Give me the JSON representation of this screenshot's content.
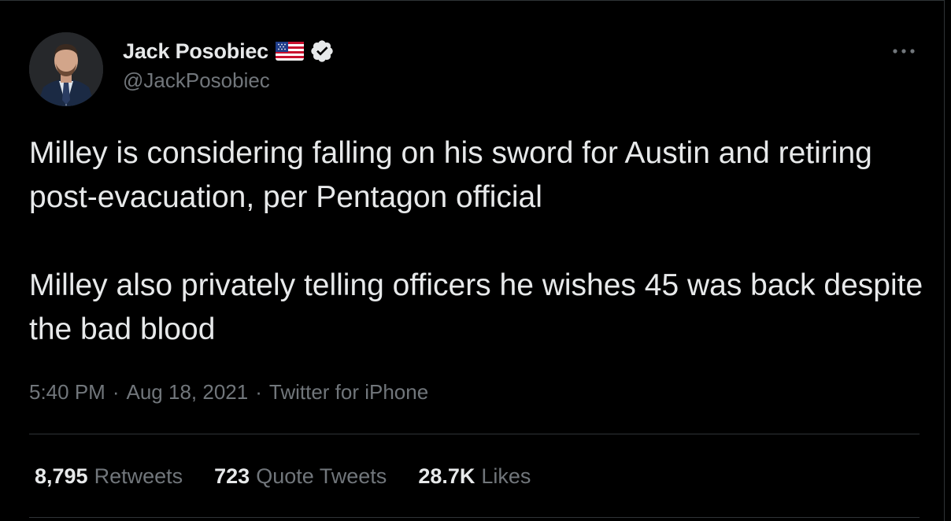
{
  "author": {
    "display_name": "Jack Posobiec",
    "handle": "@JackPosobiec",
    "flag_icon": "us-flag-icon",
    "verified_icon": "verified-badge-icon"
  },
  "tweet": {
    "paragraphs": [
      "Milley is considering falling on his sword for Austin and retiring post-evacuation, per Pentagon official",
      "Milley also privately telling officers he wishes 45 was back despite the bad blood"
    ],
    "time": "5:40 PM",
    "date": "Aug 18, 2021",
    "source": "Twitter for iPhone",
    "separator": "·"
  },
  "stats": {
    "retweets": {
      "count": "8,795",
      "label": "Retweets"
    },
    "quote_tweets": {
      "count": "723",
      "label": "Quote Tweets"
    },
    "likes": {
      "count": "28.7K",
      "label": "Likes"
    }
  },
  "colors": {
    "background": "#000000",
    "primary_text": "#e7e9ea",
    "secondary_text": "#71767b",
    "divider": "#2f3336",
    "verified": "#e7e9ea"
  }
}
